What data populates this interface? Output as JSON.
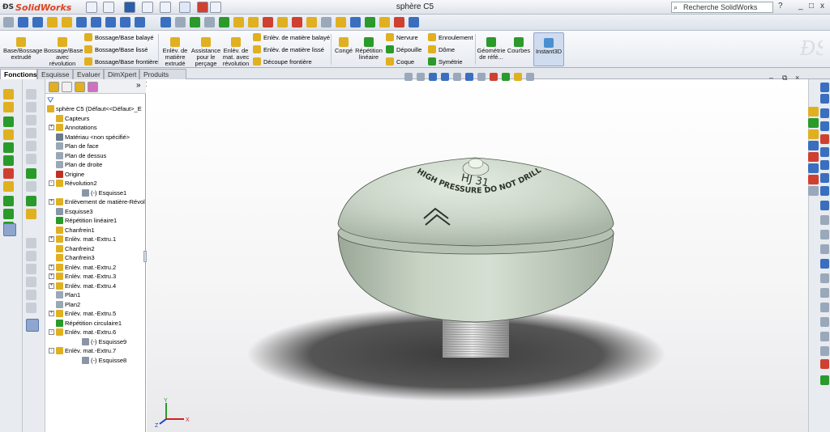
{
  "app": {
    "name": "SolidWorks",
    "doc_title": "sphère C5"
  },
  "search": {
    "placeholder": "Recherche SolidWorks"
  },
  "window_controls": {
    "help": "?",
    "minimize": "_",
    "restore": "□",
    "close": "x"
  },
  "ribbon": {
    "big": [
      {
        "label": "Base/Bossage extrudé",
        "color": "#e0b020"
      },
      {
        "label": "Bossage/Base avec révolution",
        "color": "#e0b020"
      },
      {
        "label": "Enlèv. de matière extrudé",
        "color": "#e0b020"
      },
      {
        "label": "Assistance pour le perçage",
        "color": "#e0b020"
      },
      {
        "label": "Enlèv. de mat. avec révolution",
        "color": "#e0b020"
      },
      {
        "label": "Congé",
        "color": "#e0b020"
      },
      {
        "label": "Répétition linéaire",
        "color": "#2a9a2a"
      },
      {
        "label": "Géométrie de réfé...",
        "color": "#2a9a2a"
      },
      {
        "label": "Courbes",
        "color": "#2a9a2a"
      },
      {
        "label": "Instant3D",
        "color": "#4a90d0"
      }
    ],
    "small": [
      {
        "label": "Bossage/Base balayé"
      },
      {
        "label": "Bossage/Base lissé"
      },
      {
        "label": "Bossage/Base frontière"
      },
      {
        "label": "Enlèv. de matière balayé"
      },
      {
        "label": "Enlèv. de matière lissé"
      },
      {
        "label": "Découpe frontière"
      },
      {
        "label": "Nervure"
      },
      {
        "label": "Dépouille"
      },
      {
        "label": "Coque"
      },
      {
        "label": "Enroulement"
      },
      {
        "label": "Dôme"
      },
      {
        "label": "Symétrie"
      }
    ]
  },
  "tabs": [
    "Fonctions",
    "Esquisse",
    "Evaluer",
    "DimXpert",
    "Produits Office"
  ],
  "tree": {
    "root": "sphère C5  (Défaut<<Défaut>_E",
    "items": [
      {
        "label": "Capteurs",
        "indent": 1,
        "color": "#e0b020",
        "expand": ""
      },
      {
        "label": "Annotations",
        "indent": 1,
        "color": "#e0b020",
        "expand": "+"
      },
      {
        "label": "Matériau <non spécifié>",
        "indent": 1,
        "color": "#6a7b8a",
        "expand": ""
      },
      {
        "label": "Plan de face",
        "indent": 1,
        "color": "#9aa7b5",
        "expand": ""
      },
      {
        "label": "Plan de dessus",
        "indent": 1,
        "color": "#9aa7b5",
        "expand": ""
      },
      {
        "label": "Plan de droite",
        "indent": 1,
        "color": "#9aa7b5",
        "expand": ""
      },
      {
        "label": "Origine",
        "indent": 1,
        "color": "#c03020",
        "expand": ""
      },
      {
        "label": "Révolution2",
        "indent": 1,
        "color": "#e0b020",
        "expand": "-"
      },
      {
        "label": "(-) Esquisse1",
        "indent": 2,
        "color": "#8a96a6",
        "expand": ""
      },
      {
        "label": "Enlèvement de matière-Révol",
        "indent": 1,
        "color": "#e0b020",
        "expand": "+"
      },
      {
        "label": "Esquisse3",
        "indent": 1,
        "color": "#8a96a6",
        "expand": ""
      },
      {
        "label": "Répétition linéaire1",
        "indent": 1,
        "color": "#2a9a2a",
        "expand": ""
      },
      {
        "label": "Chanfrein1",
        "indent": 1,
        "color": "#e0b020",
        "expand": ""
      },
      {
        "label": "Enlèv. mat.-Extru.1",
        "indent": 1,
        "color": "#e0b020",
        "expand": "+"
      },
      {
        "label": "Chanfrein2",
        "indent": 1,
        "color": "#e0b020",
        "expand": ""
      },
      {
        "label": "Chanfrein3",
        "indent": 1,
        "color": "#e0b020",
        "expand": ""
      },
      {
        "label": "Enlèv. mat.-Extru.2",
        "indent": 1,
        "color": "#e0b020",
        "expand": "+"
      },
      {
        "label": "Enlèv. mat.-Extru.3",
        "indent": 1,
        "color": "#e0b020",
        "expand": "+"
      },
      {
        "label": "Enlèv. mat.-Extru.4",
        "indent": 1,
        "color": "#e0b020",
        "expand": "+"
      },
      {
        "label": "Plan1",
        "indent": 1,
        "color": "#9aa7b5",
        "expand": ""
      },
      {
        "label": "Plan2",
        "indent": 1,
        "color": "#9aa7b5",
        "expand": ""
      },
      {
        "label": "Enlèv. mat.-Extru.5",
        "indent": 1,
        "color": "#e0b020",
        "expand": "+"
      },
      {
        "label": "Répétition circulaire1",
        "indent": 1,
        "color": "#2a9a2a",
        "expand": ""
      },
      {
        "label": "Enlèv. mat.-Extru.6",
        "indent": 1,
        "color": "#e0b020",
        "expand": "-"
      },
      {
        "label": "(-) Esquisse9",
        "indent": 2,
        "color": "#8a96a6",
        "expand": ""
      },
      {
        "label": "Enlèv. mat.-Extru.7",
        "indent": 1,
        "color": "#e0b020",
        "expand": "-"
      },
      {
        "label": "(-) Esquisse8",
        "indent": 2,
        "color": "#8a96a6",
        "expand": ""
      }
    ]
  },
  "model": {
    "engraving_main": "HJ  31",
    "engraving_arc": "HIGH PRESSURE DO NOT DRILL OR INCINERATE",
    "body_color": "#c9d4c6"
  },
  "triad": {
    "x": "X",
    "y": "Y",
    "z": "Z"
  }
}
